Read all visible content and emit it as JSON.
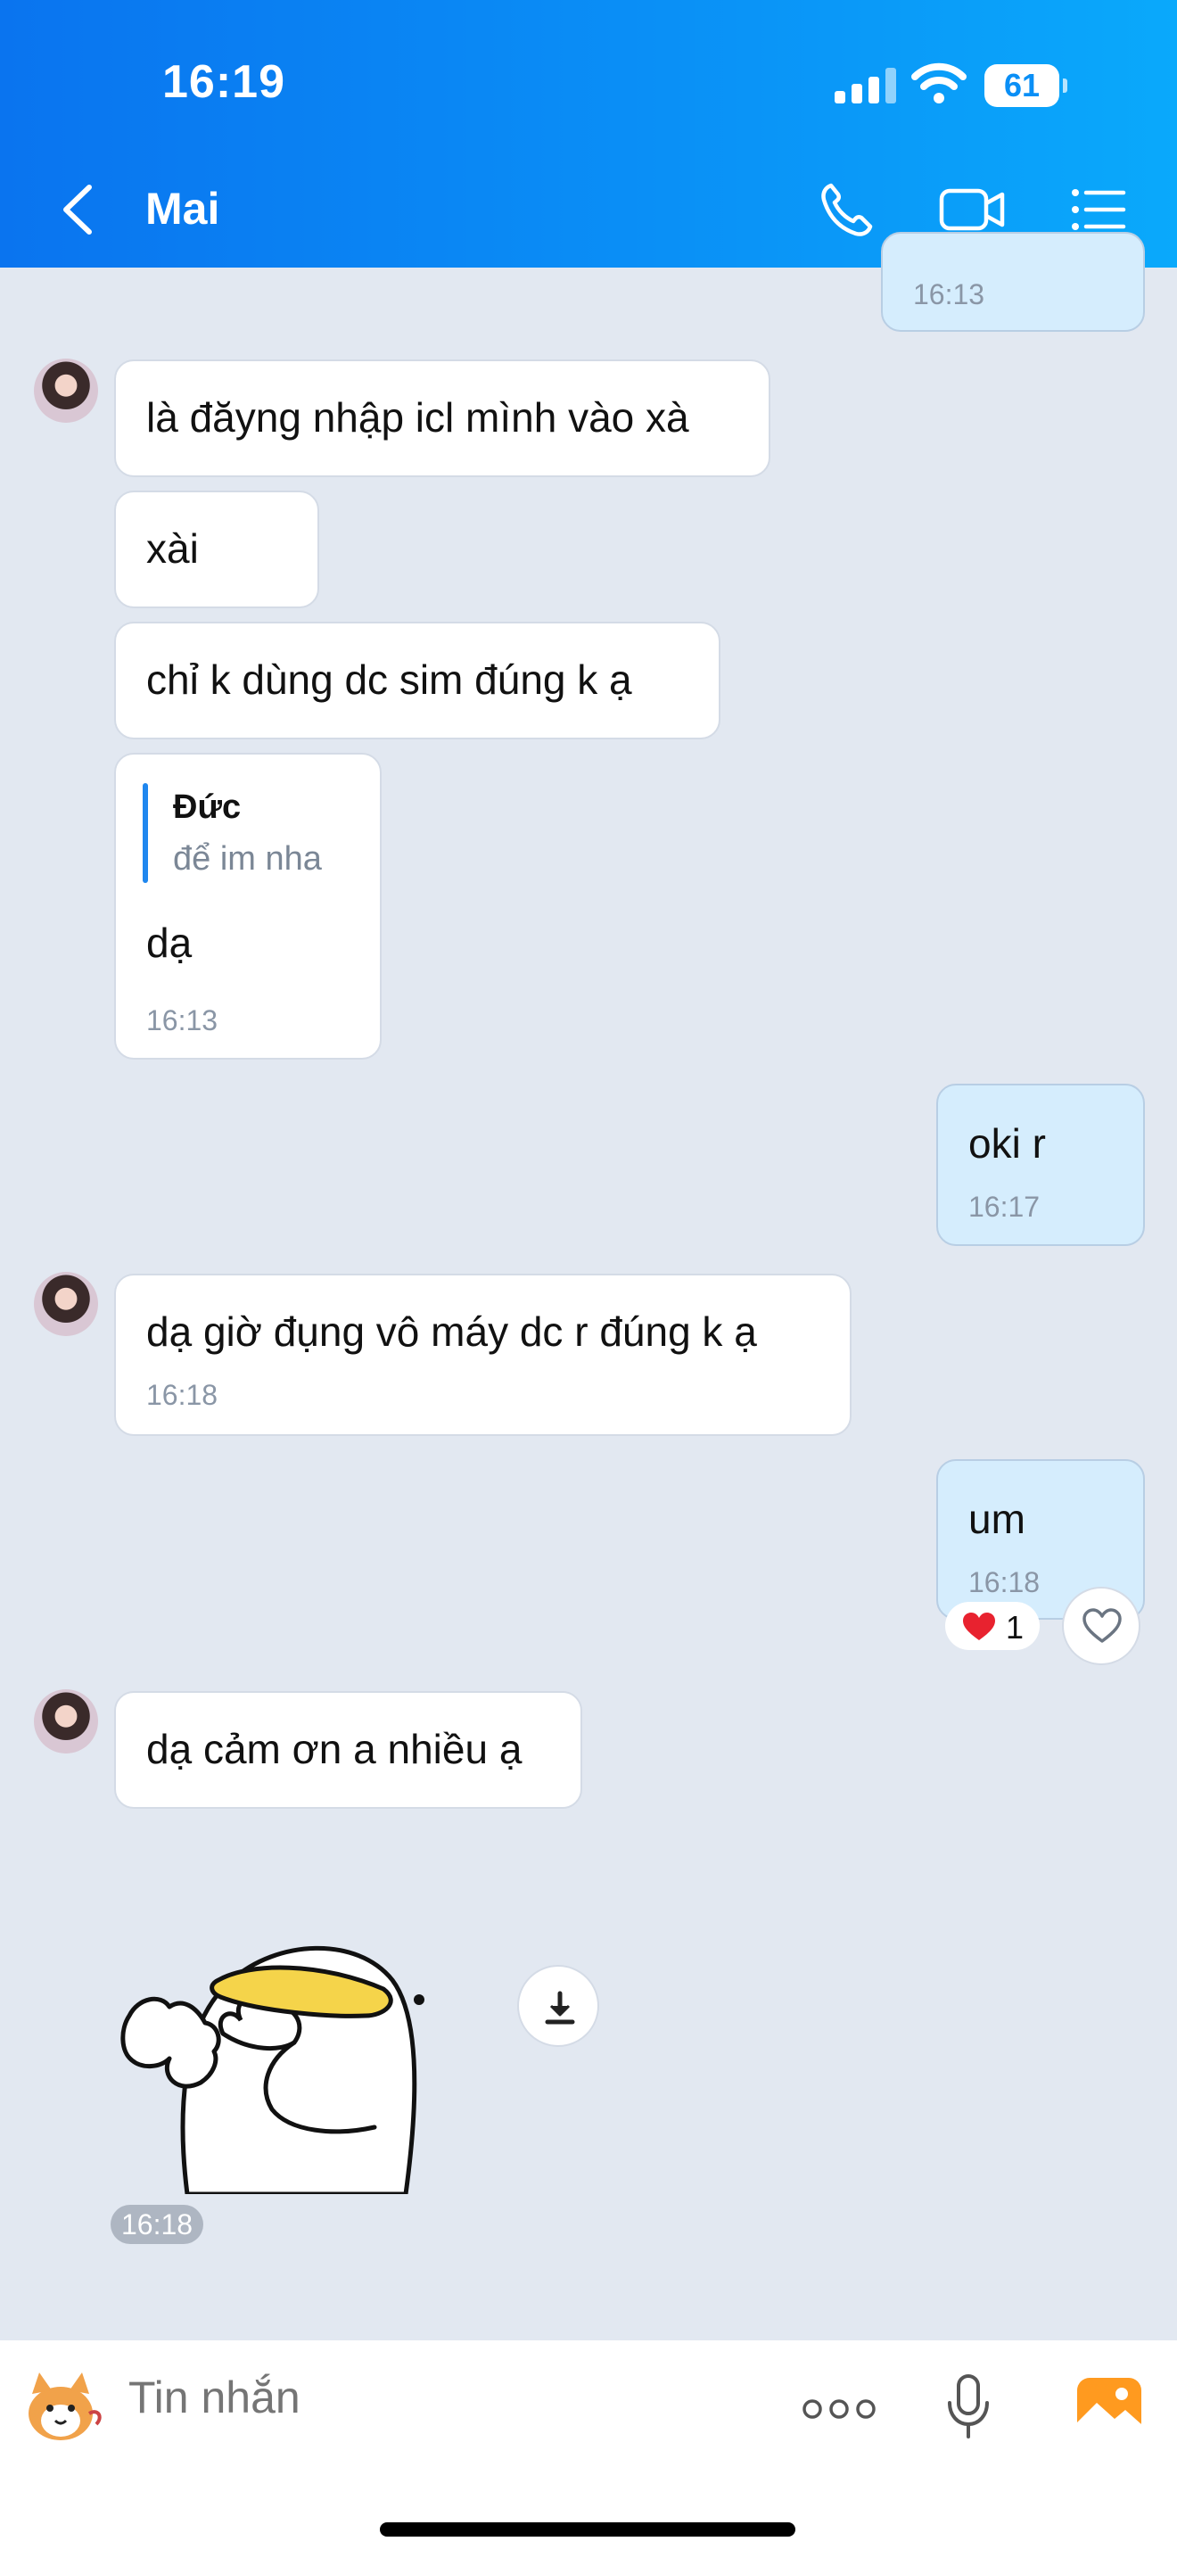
{
  "status_bar": {
    "time": "16:19",
    "battery": "61"
  },
  "header": {
    "title": "Mai"
  },
  "messages": [
    {
      "time": "16:13"
    },
    {
      "text": "là đăyng nhập icl mình vào xà"
    },
    {
      "text": "xài"
    },
    {
      "text": "chỉ k dùng dc sim đúng k ạ"
    },
    {
      "quote_name": "Đức",
      "quote_text": "để im nha",
      "text": "dạ",
      "time": "16:13"
    },
    {
      "text": "oki r",
      "time": "16:17"
    },
    {
      "text": "dạ giờ đụng vô máy dc r đúng k ạ",
      "time": "16:18"
    },
    {
      "text": "um",
      "time": "16:18",
      "reaction_count": "1"
    },
    {
      "text": "dạ cảm ơn a nhiều ạ"
    },
    {
      "time": "16:18"
    }
  ],
  "composer": {
    "placeholder": "Tin nhắn"
  },
  "colors": {
    "header_start": "#0a74ef",
    "header_end": "#0aa9fb",
    "my_bubble": "#d5edfd",
    "chat_bg": "#e2e8f1",
    "accent": "#1f87ef",
    "gallery_icon": "#ff9a1f"
  },
  "icons": [
    "back-icon",
    "phone-icon",
    "video-call-icon",
    "menu-list-icon",
    "heart-icon",
    "download-icon",
    "sticker-icon",
    "more-icon",
    "microphone-icon",
    "gallery-icon"
  ]
}
